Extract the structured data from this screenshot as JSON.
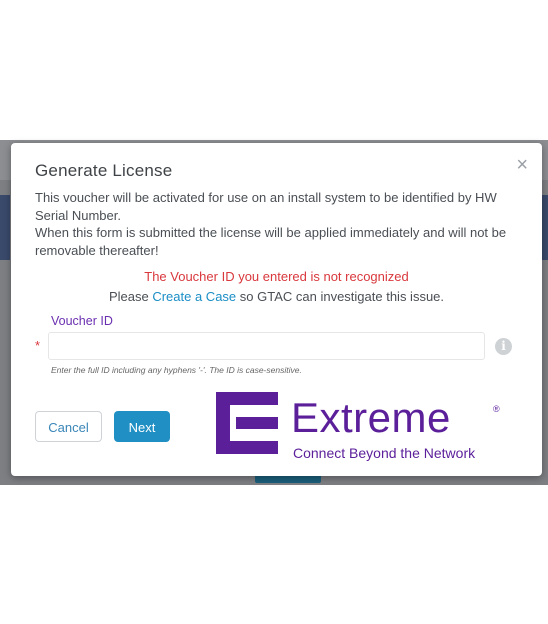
{
  "modal": {
    "title": "Generate License",
    "close_symbol": "×",
    "description_line1": "This voucher will be activated for use on an install system to be identified by HW Serial Number.",
    "description_line2": "When this form is submitted the license will be applied immediately and will not be removable thereafter!",
    "error_message": "The Voucher ID you entered is not recognized",
    "help_prefix": "Please",
    "help_link": "Create a Case",
    "help_suffix": "so GTAC can investigate this issue.",
    "field": {
      "label": "Voucher ID",
      "required_marker": "*",
      "value": "",
      "hint": "Enter the full ID including any hyphens '-'. The ID is case-sensitive."
    },
    "buttons": {
      "cancel_label": "Cancel",
      "next_label": "Next"
    }
  },
  "logo": {
    "wordmark": "Extreme",
    "registered": "®",
    "tagline": "Connect Beyond the Network",
    "color": "#5b1f9a"
  },
  "colors": {
    "error": "#d9383d",
    "link": "#1a8ec6",
    "primary_button": "#1f8fc4",
    "label_purple": "#6a2fb0"
  },
  "icons": {
    "info": "info-icon",
    "close": "close-icon"
  }
}
